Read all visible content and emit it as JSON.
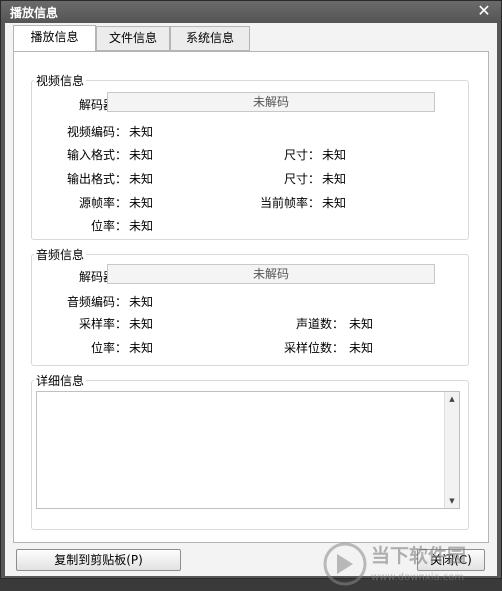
{
  "window": {
    "title": "播放信息",
    "close_symbol": "✕"
  },
  "tabs": [
    {
      "label": "播放信息",
      "active": true
    },
    {
      "label": "文件信息",
      "active": false
    },
    {
      "label": "系统信息",
      "active": false
    }
  ],
  "video": {
    "legend": "视频信息",
    "decoder_label": "解码器：",
    "decoder_value": "未解码",
    "codec_label": "视频编码：",
    "codec_value": "未知",
    "input_format_label": "输入格式：",
    "input_format_value": "未知",
    "input_size_label": "尺寸：",
    "input_size_value": "未知",
    "output_format_label": "输出格式：",
    "output_format_value": "未知",
    "output_size_label": "尺寸：",
    "output_size_value": "未知",
    "source_fps_label": "源帧率：",
    "source_fps_value": "未知",
    "current_fps_label": "当前帧率：",
    "current_fps_value": "未知",
    "bitrate_label": "位率：",
    "bitrate_value": "未知"
  },
  "audio": {
    "legend": "音频信息",
    "decoder_label": "解码器：",
    "decoder_value": "未解码",
    "codec_label": "音频编码：",
    "codec_value": "未知",
    "sample_rate_label": "采样率：",
    "sample_rate_value": "未知",
    "channels_label": "声道数：",
    "channels_value": "未知",
    "bitrate_label": "位率：",
    "bitrate_value": "未知",
    "bits_label": "采样位数：",
    "bits_value": "未知"
  },
  "details": {
    "legend": "详细信息"
  },
  "buttons": {
    "copy": "复制到剪贴板(P)",
    "close": "关闭(C)"
  },
  "watermark": {
    "brand": "当下软件园",
    "url": "www.downxia.com"
  }
}
